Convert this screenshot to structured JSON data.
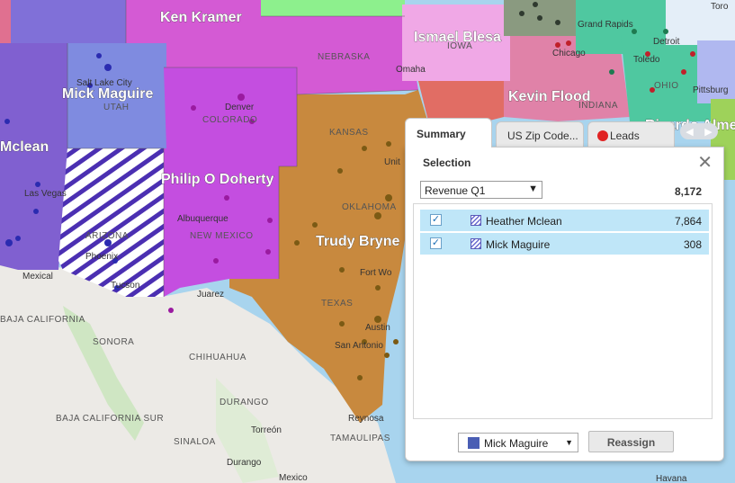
{
  "map": {
    "territories": [
      {
        "name": "Ken Kramer",
        "color": "#d45ad4"
      },
      {
        "name": "Ismael Blesa",
        "color": "#f0a8e6"
      },
      {
        "name": "Mick Maguire",
        "color": "#7f8be0"
      },
      {
        "name": "Mclean",
        "color": "#8060d0"
      },
      {
        "name": "Philip O Doherty",
        "color": "#c44ee0"
      },
      {
        "name": "Trudy Bryne",
        "color": "#c8893e"
      },
      {
        "name": "Kevin Flood",
        "color": "#e082a8"
      },
      {
        "name": "Ricardo Alme",
        "color": "#4fc8a0"
      }
    ],
    "state_labels": [
      "NEBRASKA",
      "IOWA",
      "UTAH",
      "COLORADO",
      "KANSAS",
      "INDIANA",
      "OHIO",
      "ARIZONA",
      "NEW MEXICO",
      "OKLAHOMA",
      "TEXAS",
      "BAJA CALIFORNIA",
      "SONORA",
      "CHIHUAHUA",
      "DURANGO",
      "BAJA CALIFORNIA SUR",
      "SINALOA",
      "TAMAULIPAS"
    ],
    "city_labels": [
      "Salt Lake City",
      "Denver",
      "Omaha",
      "Chicago",
      "Detroit",
      "Toledo",
      "Pittsburg",
      "Grand Rapids",
      "Toro",
      "Las Vegas",
      "Phoenix",
      "Tucson",
      "Albuquerque",
      "Juarez",
      "Fort Wo",
      "Austin",
      "San Antonio",
      "Reynosa",
      "Torreón",
      "Durango",
      "Mexico",
      "Mexical",
      "Unit",
      "Havana"
    ]
  },
  "panel": {
    "tabs": [
      {
        "label": "Summary"
      },
      {
        "label": "US Zip Code..."
      },
      {
        "label": "Leads"
      }
    ],
    "selection_title": "Selection",
    "metric": "Revenue Q1",
    "total": "8,172",
    "rows": [
      {
        "name": "Heather Mclean",
        "value": "7,864"
      },
      {
        "name": "Mick Maguire",
        "value": "308"
      }
    ],
    "assign_to": "Mick Maguire",
    "reassign_label": "Reassign"
  },
  "colors": {
    "leads_dot": "#e02323",
    "selected_row": "#bfe6f8",
    "assign_swatch": "#4a5eb4"
  }
}
